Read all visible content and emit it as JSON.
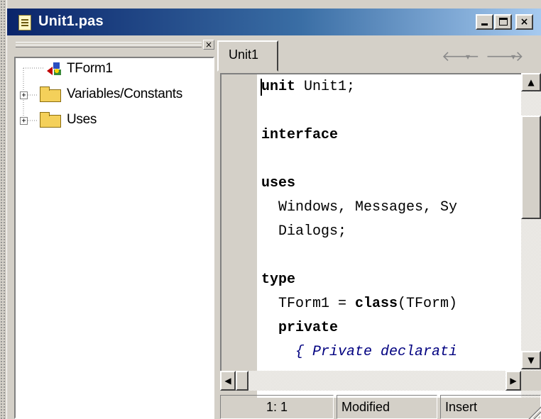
{
  "window": {
    "title": "Unit1.pas",
    "title_icon": "document-icon",
    "colors": {
      "titlebar_start": "#0a246a",
      "titlebar_end": "#a6caf0",
      "face": "#d4d0c8"
    }
  },
  "title_buttons": {
    "minimize": "minimize-icon",
    "maximize": "maximize-icon",
    "close": "×"
  },
  "tree_panel": {
    "close_label": "×",
    "items": [
      {
        "label": "TForm1",
        "icon": "form-icon",
        "expandable": false
      },
      {
        "label": "Variables/Constants",
        "icon": "folder-icon",
        "expandable": true,
        "expander": "+"
      },
      {
        "label": "Uses",
        "icon": "folder-icon",
        "expandable": true,
        "expander": "+"
      }
    ]
  },
  "editor": {
    "tabs": [
      {
        "label": "Unit1"
      }
    ],
    "nav": {
      "back": "🡐",
      "back_dropdown": "▾",
      "forward": "🡒",
      "forward_dropdown": "▾"
    },
    "code_lines": [
      {
        "parts": [
          {
            "t": "unit",
            "k": "kw"
          },
          {
            "t": " Unit1;",
            "k": ""
          }
        ]
      },
      {
        "parts": []
      },
      {
        "parts": [
          {
            "t": "interface",
            "k": "kw"
          }
        ]
      },
      {
        "parts": []
      },
      {
        "parts": [
          {
            "t": "uses",
            "k": "kw"
          }
        ]
      },
      {
        "parts": [
          {
            "t": "  Windows, Messages, Sy",
            "k": ""
          }
        ]
      },
      {
        "parts": [
          {
            "t": "  Dialogs;",
            "k": ""
          }
        ]
      },
      {
        "parts": []
      },
      {
        "parts": [
          {
            "t": "type",
            "k": "kw"
          }
        ]
      },
      {
        "parts": [
          {
            "t": "  TForm1 = ",
            "k": ""
          },
          {
            "t": "class",
            "k": "kw"
          },
          {
            "t": "(TForm)",
            "k": ""
          }
        ]
      },
      {
        "parts": [
          {
            "t": "  private",
            "k": "kw"
          }
        ]
      },
      {
        "parts": [
          {
            "t": "    { Private declarati",
            "k": "cm"
          }
        ]
      }
    ],
    "scroll": {
      "up": "▲",
      "down": "▼",
      "left": "◀",
      "right": "▶"
    }
  },
  "statusbar": {
    "position": "1:  1",
    "modified": "Modified",
    "mode": "Insert"
  }
}
